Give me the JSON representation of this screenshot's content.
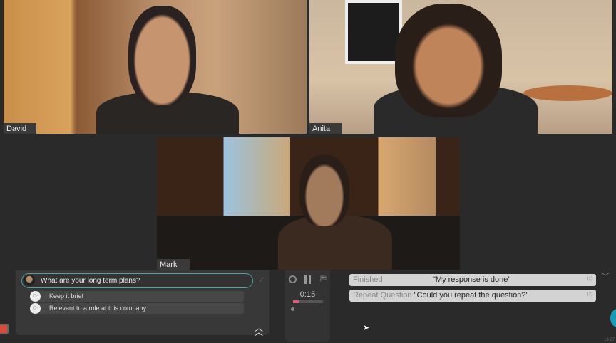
{
  "participants": [
    {
      "name": "David"
    },
    {
      "name": "Anita"
    },
    {
      "name": "Mark"
    }
  ],
  "question": {
    "text": "What are your long term plans?",
    "hints": [
      {
        "key_icon": "key-icon",
        "text": "Keep it brief"
      },
      {
        "key_icon": "key-icon",
        "text": "Relevant to a role at this company"
      }
    ]
  },
  "controls": {
    "timer": "0:15",
    "progress": 0.2
  },
  "responses": [
    {
      "label": "Finished",
      "phrase": "\"My response is done\"",
      "shortcut": "(1)"
    },
    {
      "label": "Repeat Question",
      "phrase": "\"Could you repeat the question?\"",
      "shortcut": "(2)"
    }
  ],
  "clock": "13:27",
  "colors": {
    "accent": "#4aa3a8",
    "record": "#d94a3c",
    "progress": "#e8567a"
  }
}
